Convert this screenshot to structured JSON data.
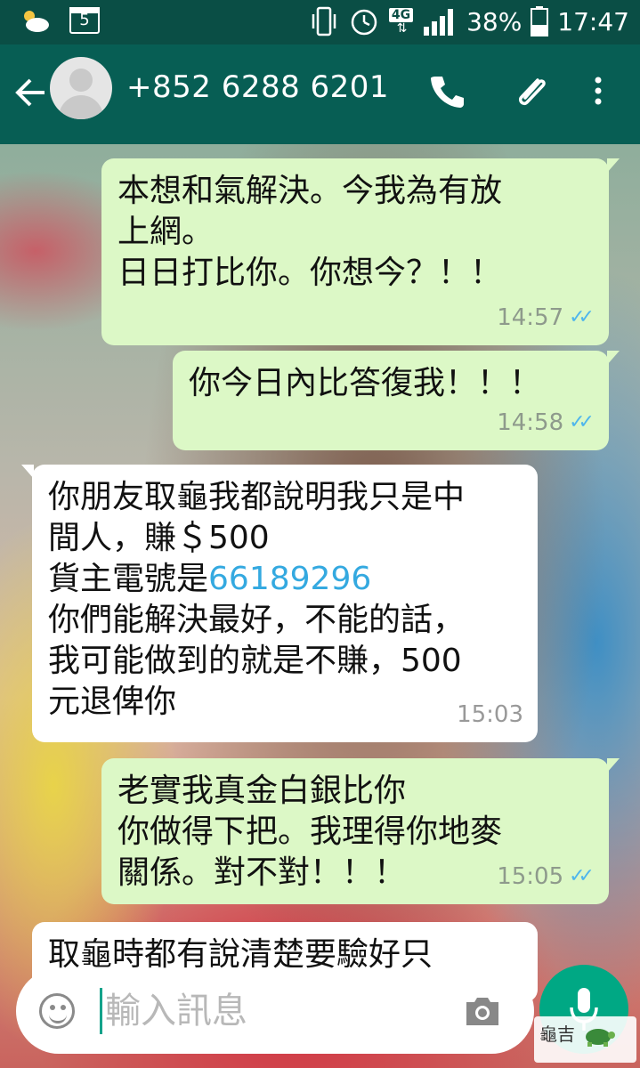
{
  "status_bar": {
    "network": "4G",
    "battery": "38%",
    "time": "17:47",
    "calendar_day": "5"
  },
  "header": {
    "contact": "+852 6288 6201",
    "icons": [
      "back-arrow-icon",
      "avatar",
      "phone-icon",
      "attach-icon",
      "more-vert-icon"
    ]
  },
  "messages": [
    {
      "direction": "outgoing",
      "text": "本想和氣解決。今我為有放\n上網。\n日日打比你。你想今？！！",
      "time": "14:57",
      "read": true
    },
    {
      "direction": "outgoing",
      "text": "你今日內比答復我！！！",
      "time": "14:58",
      "read": true
    },
    {
      "direction": "incoming",
      "text_before_link": "你朋友取龜我都說明我只是中\n間人，賺＄500\n貨主電號是",
      "link": "66189296",
      "text_after_link": "\n你們能解決最好，不能的話，\n我可能做到的就是不賺，500\n元退俾你",
      "time": "15:03"
    },
    {
      "direction": "outgoing",
      "text": "老實我真金白銀比你\n你做得下把。我理得你地麥\n關係。對不對！！！",
      "time": "15:05",
      "read": true
    },
    {
      "direction": "incoming",
      "text": "取龜時都有說清楚要驗好只"
    }
  ],
  "composer": {
    "placeholder": "輸入訊息"
  },
  "watermark": {
    "text": "龜吉"
  },
  "colors": {
    "header": "#075e54",
    "outgoing_bubble": "#dcf8c6",
    "incoming_bubble": "#ffffff",
    "fab": "#00a884",
    "link": "#34a9e0"
  }
}
